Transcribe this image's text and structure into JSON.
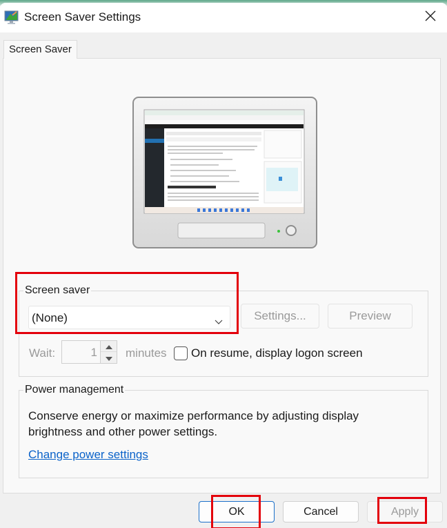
{
  "window": {
    "title": "Screen Saver Settings",
    "icon": "screen-saver-app-icon",
    "close_icon": "close-icon"
  },
  "tabs": [
    {
      "label": "Screen Saver",
      "active": true
    }
  ],
  "preview": {
    "icon": "monitor-preview-icon"
  },
  "screen_saver": {
    "group_label": "Screen saver",
    "selected": "(None)",
    "settings_label": "Settings...",
    "preview_label": "Preview",
    "wait_label": "Wait:",
    "wait_value": "1",
    "minutes_label": "minutes",
    "on_resume_label": "On resume, display logon screen",
    "on_resume_checked": false
  },
  "power": {
    "group_label": "Power management",
    "description": "Conserve energy or maximize performance by adjusting display brightness and other power settings.",
    "link_label": "Change power settings"
  },
  "footer": {
    "ok_label": "OK",
    "cancel_label": "Cancel",
    "apply_label": "Apply"
  },
  "colors": {
    "highlight": "#e3000b",
    "link": "#0a62c9",
    "primary_border": "#1a6fc9"
  }
}
